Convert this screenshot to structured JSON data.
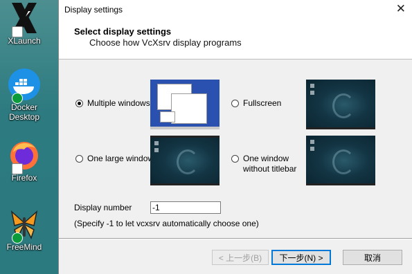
{
  "desktop": {
    "icons": [
      {
        "label": "XLaunch",
        "icon": "xlaunch-icon"
      },
      {
        "label": "Docker\nDesktop",
        "icon": "docker-icon"
      },
      {
        "label": "Firefox",
        "icon": "firefox-icon"
      },
      {
        "label": "FreeMind",
        "icon": "freemind-icon"
      }
    ]
  },
  "dialog": {
    "title": "Display settings",
    "close_glyph": "✕",
    "header_title": "Select display settings",
    "header_subtitle": "Choose how VcXsrv display programs",
    "options": [
      {
        "label": "Multiple windows",
        "selected": true
      },
      {
        "label": "Fullscreen",
        "selected": false
      },
      {
        "label": "One large window",
        "selected": false
      },
      {
        "label": "One window\nwithout titlebar",
        "selected": false
      }
    ],
    "display_number_label": "Display number",
    "display_number_value": "-1",
    "hint": "(Specify -1 to let vcxsrv automatically choose one)",
    "buttons": {
      "back": "< 上一步(B)",
      "next": "下一步(N) >",
      "cancel": "取消"
    }
  },
  "colors": {
    "desktop_bg": "#2f7f86",
    "accent_focus": "#0078d7"
  }
}
